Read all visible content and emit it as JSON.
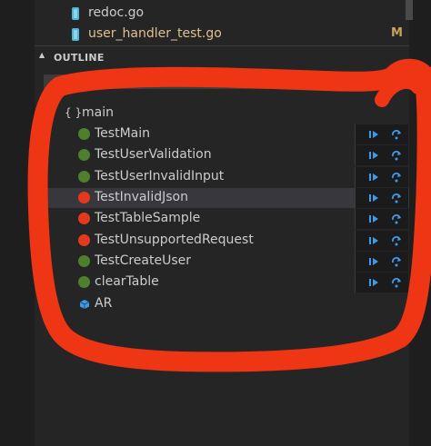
{
  "files": [
    {
      "name": "redoc.go",
      "modified": false,
      "status": ""
    },
    {
      "name": "user_handler_test.go",
      "modified": true,
      "status": "M"
    }
  ],
  "outline": {
    "header": "OUTLINE",
    "root": "main",
    "items": [
      {
        "label": "TestMain",
        "state": "pass",
        "selected": false
      },
      {
        "label": "TestUserValidation",
        "state": "pass",
        "selected": false
      },
      {
        "label": "TestUserInvalidInput",
        "state": "pass",
        "selected": false
      },
      {
        "label": "TestInvalidJson",
        "state": "fail",
        "selected": true
      },
      {
        "label": "TestTableSample",
        "state": "fail",
        "selected": false
      },
      {
        "label": "TestUnsupportedRequest",
        "state": "fail",
        "selected": false
      },
      {
        "label": "TestCreateUser",
        "state": "pass",
        "selected": false
      },
      {
        "label": "clearTable",
        "state": "pass",
        "selected": false
      }
    ],
    "variable": "AR"
  },
  "colors": {
    "pass": "#4e7f2d",
    "fail": "#e5391d",
    "annotation": "#ee3514",
    "action_icon": "#3e9be9",
    "modified": "#e2c08d"
  }
}
